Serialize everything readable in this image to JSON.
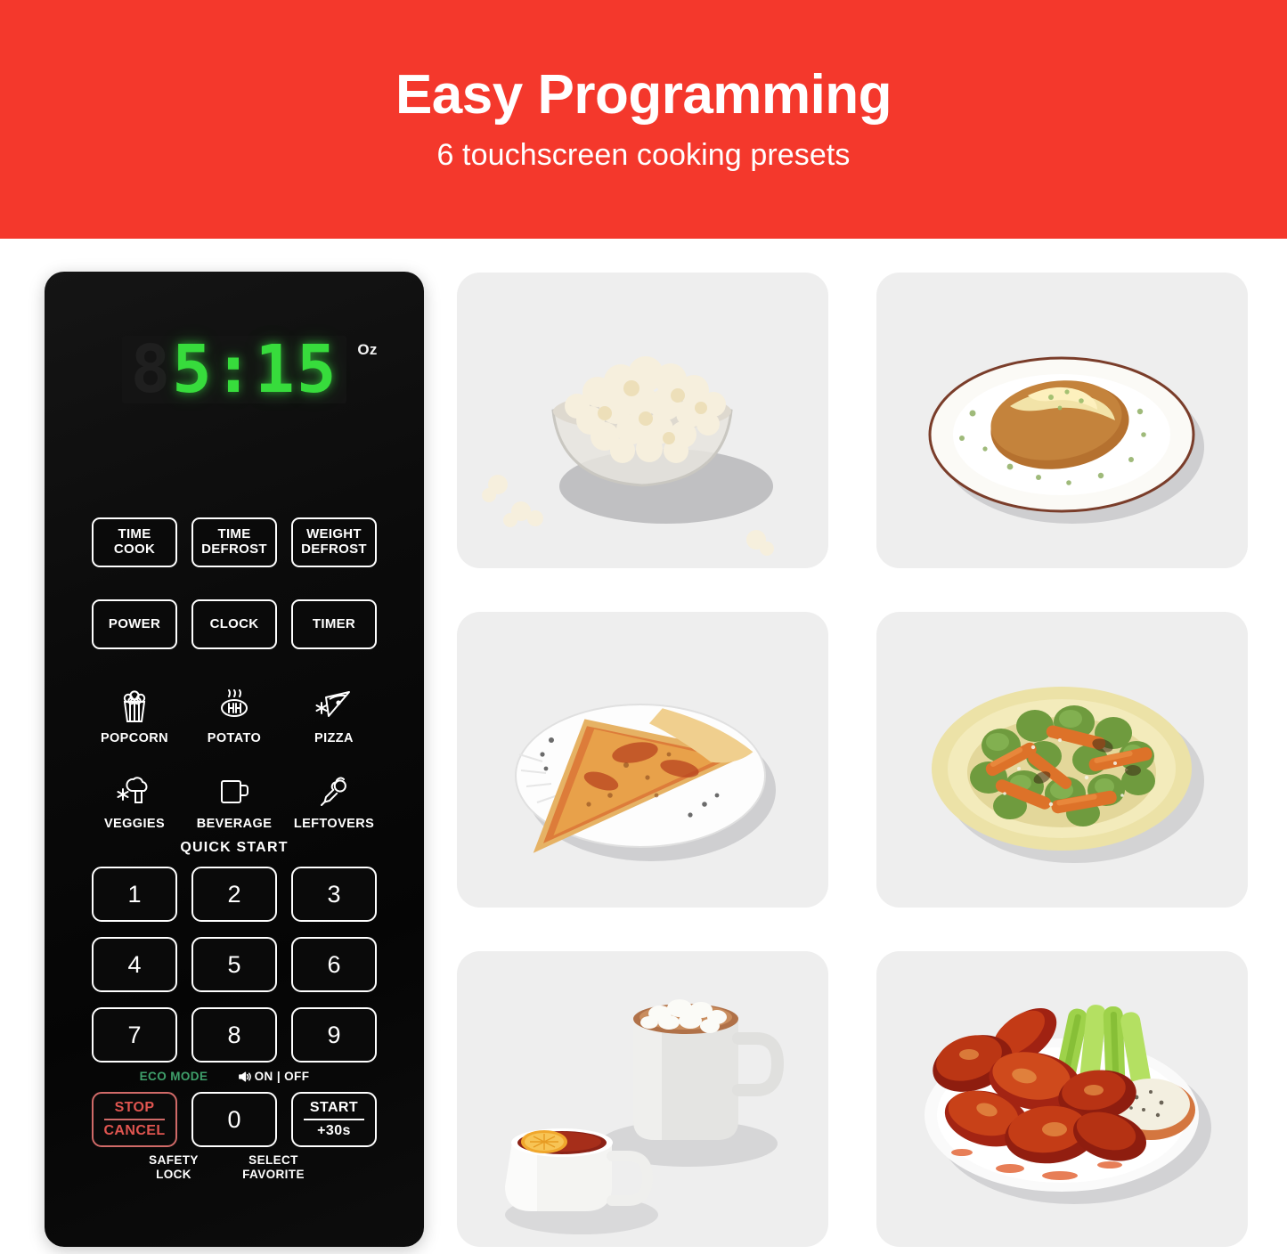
{
  "banner": {
    "title": "Easy Programming",
    "subtitle": "6 touchscreen cooking presets",
    "bg_color": "#F4382C",
    "text_color": "#FFFFFF"
  },
  "control_panel": {
    "body_color": "#0A0A0A",
    "display": {
      "ghost_digit": "8",
      "value": "5:15",
      "unit_label": "Oz",
      "led_color": "#37DC3C"
    },
    "function_buttons_row1": [
      {
        "name": "time-cook",
        "line1": "TIME",
        "line2": "COOK"
      },
      {
        "name": "time-defrost",
        "line1": "TIME",
        "line2": "DEFROST"
      },
      {
        "name": "weight-defrost",
        "line1": "WEIGHT",
        "line2": "DEFROST"
      }
    ],
    "function_buttons_row2": [
      {
        "name": "power",
        "label": "POWER"
      },
      {
        "name": "clock",
        "label": "CLOCK"
      },
      {
        "name": "timer",
        "label": "TIMER"
      }
    ],
    "presets": [
      {
        "name": "popcorn",
        "label": "POPCORN",
        "icon": "popcorn-icon"
      },
      {
        "name": "potato",
        "label": "POTATO",
        "icon": "potato-steam-icon"
      },
      {
        "name": "pizza",
        "label": "PIZZA",
        "icon": "pizza-slice-snowflake-icon"
      },
      {
        "name": "veggies",
        "label": "VEGGIES",
        "icon": "broccoli-snowflake-icon"
      },
      {
        "name": "beverage",
        "label": "BEVERAGE",
        "icon": "mug-icon"
      },
      {
        "name": "leftovers",
        "label": "LEFTOVERS",
        "icon": "chicken-leg-icon"
      }
    ],
    "quick_start_label": "QUICK START",
    "keypad": [
      "1",
      "2",
      "3",
      "4",
      "5",
      "6",
      "7",
      "8",
      "9"
    ],
    "secondary_labels": {
      "eco_mode": "ECO MODE",
      "eco_mode_color": "#3FA06B",
      "sound_toggle": "ON | OFF",
      "sound_icon": "speaker-icon"
    },
    "bottom_row": {
      "stop": {
        "line1": "STOP",
        "line2": "CANCEL",
        "color": "#E05550",
        "sublabel_line1": "SAFETY",
        "sublabel_line2": "LOCK"
      },
      "zero": {
        "label": "0",
        "sublabel_line1": "SELECT",
        "sublabel_line2": "FAVORITE"
      },
      "start": {
        "line1": "START",
        "line2": "+30s"
      }
    }
  },
  "food_tiles": [
    {
      "name": "popcorn-tile",
      "alt": "Glass bowl of buttered popcorn with scattered kernels",
      "bg": "#EEEEEE"
    },
    {
      "name": "potato-tile",
      "alt": "Baked potato with butter and chives on a rimmed plate",
      "bg": "#EEEEEE"
    },
    {
      "name": "pizza-tile",
      "alt": "Cheese pizza slice on a white paper plate",
      "bg": "#EEEEEE"
    },
    {
      "name": "veggies-tile",
      "alt": "Roasted brussels sprouts and carrots on a yellow plate",
      "bg": "#EEEEEE"
    },
    {
      "name": "beverage-tile",
      "alt": "Cup of tea with lemon and mug of cocoa with marshmallows",
      "bg": "#EEEEEE"
    },
    {
      "name": "leftovers-tile",
      "alt": "Buffalo chicken wings with celery sticks and ranch dip",
      "bg": "#EEEEEE"
    }
  ]
}
